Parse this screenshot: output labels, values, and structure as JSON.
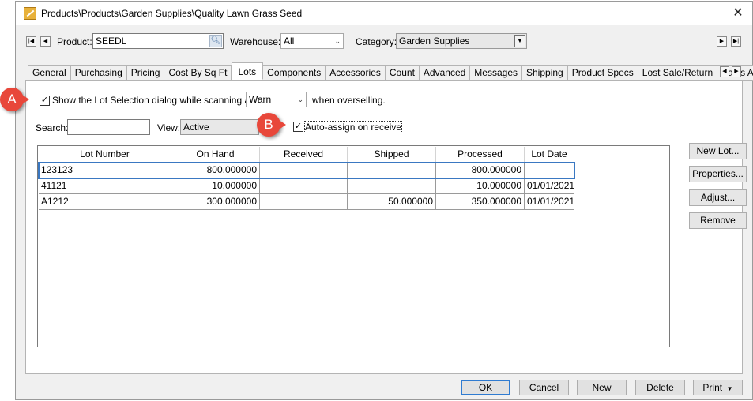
{
  "window": {
    "title": "Products\\Products\\Garden Supplies\\Quality Lawn Grass Seed"
  },
  "toolbar": {
    "product_label": "Product:",
    "product_value": "SEEDL",
    "warehouse_label": "Warehouse:",
    "warehouse_value": "All",
    "category_label": "Category:",
    "category_value": "Garden Supplies"
  },
  "tabs": [
    {
      "label": "General"
    },
    {
      "label": "Purchasing"
    },
    {
      "label": "Pricing"
    },
    {
      "label": "Cost By Sq Ft"
    },
    {
      "label": "Lots",
      "active": true
    },
    {
      "label": "Components"
    },
    {
      "label": "Accessories"
    },
    {
      "label": "Count"
    },
    {
      "label": "Advanced"
    },
    {
      "label": "Messages"
    },
    {
      "label": "Shipping"
    },
    {
      "label": "Product Specs"
    },
    {
      "label": "Lost Sale/Return"
    },
    {
      "label": "Sales Activity"
    }
  ],
  "lots": {
    "show_dialog_label": "Show the Lot Selection dialog while scanning and",
    "show_dialog_checked": true,
    "overselling_value": "Warn",
    "overselling_suffix": "when overselling.",
    "search_label": "Search:",
    "search_value": "",
    "view_label": "View:",
    "view_value": "Active",
    "auto_assign_label": "Auto-assign on receive",
    "auto_assign_checked": true,
    "columns": [
      "Lot Number",
      "On Hand",
      "Received",
      "Shipped",
      "Processed",
      "Lot Date"
    ],
    "rows": [
      [
        "123123",
        "800.000000",
        "",
        "",
        "800.000000",
        ""
      ],
      [
        "41121",
        "10.000000",
        "",
        "",
        "10.000000",
        "01/01/2021"
      ],
      [
        "A1212",
        "300.000000",
        "",
        "50.000000",
        "350.000000",
        "01/01/2021"
      ]
    ],
    "side_buttons": {
      "new_lot": "New Lot...",
      "properties": "Properties...",
      "adjust": "Adjust...",
      "remove": "Remove"
    }
  },
  "footer": {
    "ok": "OK",
    "cancel": "Cancel",
    "new": "New",
    "delete": "Delete",
    "print": "Print"
  },
  "callouts": {
    "a": "A",
    "b": "B"
  },
  "icons": {
    "close": "close-icon",
    "search": "magnifier-icon",
    "app": "pencil-app-icon"
  },
  "colors": {
    "callout": "#e8473a",
    "selection": "#3a78c2",
    "default_button": "#2f7bd1"
  }
}
